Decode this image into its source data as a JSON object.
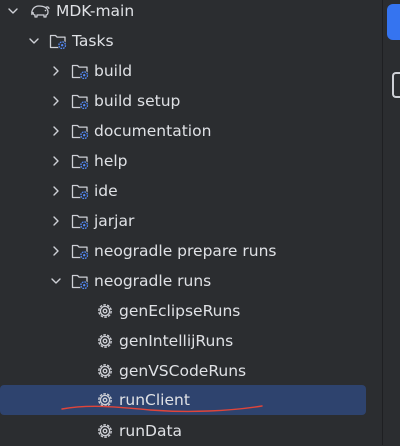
{
  "colors": {
    "background": "#2b2d30",
    "text": "#dfe1e5",
    "icon": "#ced0d6",
    "gear_accent": "#548af7",
    "selection": "#2e436e",
    "active_tool_button": "#3574f0",
    "annotation_underline": "#e0453a"
  },
  "tree": {
    "project": {
      "label": "MDK-main",
      "icon": "elephant-icon",
      "expanded": true
    },
    "tasks": {
      "label": "Tasks",
      "icon": "folder-gear-icon",
      "expanded": true
    },
    "groups": [
      {
        "label": "build",
        "expanded": false
      },
      {
        "label": "build setup",
        "expanded": false
      },
      {
        "label": "documentation",
        "expanded": false
      },
      {
        "label": "help",
        "expanded": false
      },
      {
        "label": "ide",
        "expanded": false
      },
      {
        "label": "jarjar",
        "expanded": false
      },
      {
        "label": "neogradle prepare runs",
        "expanded": false
      },
      {
        "label": "neogradle runs",
        "expanded": true
      }
    ],
    "runs": [
      {
        "label": "genEclipseRuns",
        "icon": "gear-icon",
        "selected": false
      },
      {
        "label": "genIntellijRuns",
        "icon": "gear-icon",
        "selected": false
      },
      {
        "label": "genVSCodeRuns",
        "icon": "gear-icon",
        "selected": false
      },
      {
        "label": "runClient",
        "icon": "gear-icon",
        "selected": true
      },
      {
        "label": "runData",
        "icon": "gear-icon",
        "selected": false
      }
    ]
  }
}
